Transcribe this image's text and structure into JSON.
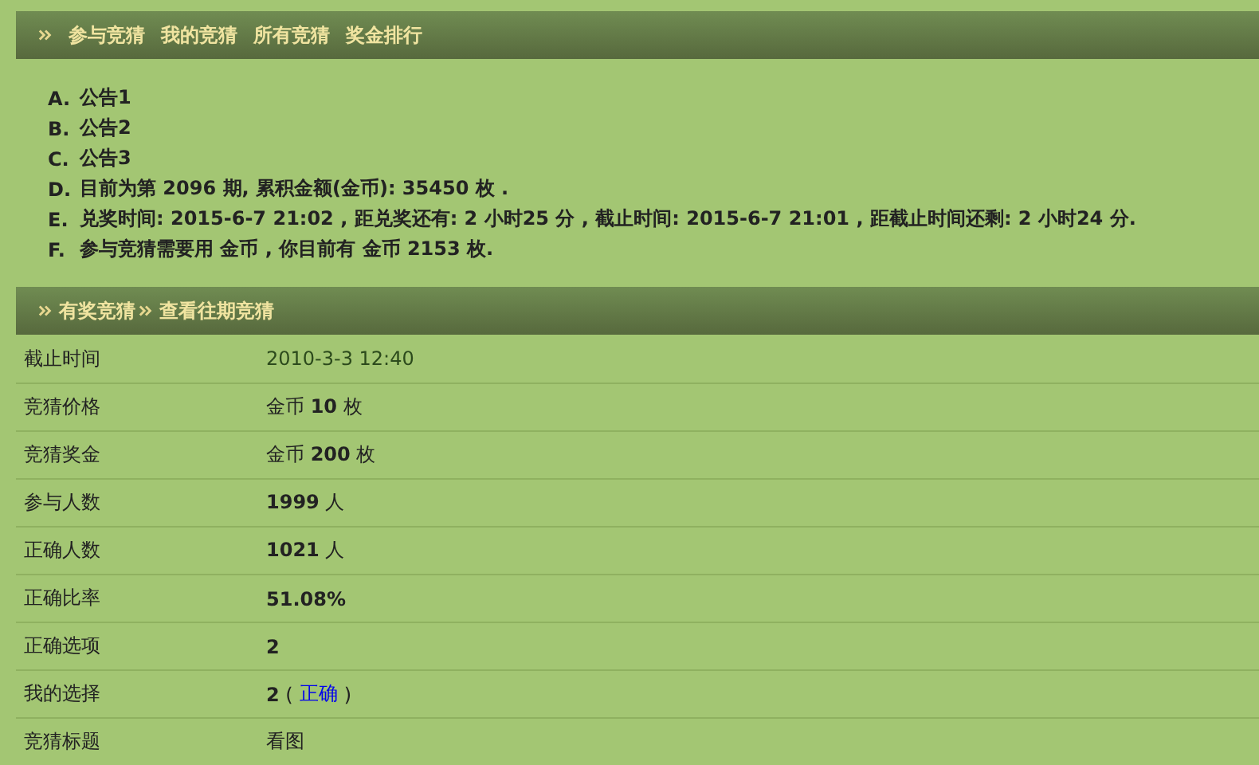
{
  "nav_bar": {
    "items": [
      "参与竞猜",
      "我的竞猜",
      "所有竞猜",
      "奖金排行"
    ]
  },
  "notices": [
    {
      "marker": "A.",
      "text": "公告1"
    },
    {
      "marker": "B.",
      "text": "公告2"
    },
    {
      "marker": "C.",
      "text": "公告3"
    },
    {
      "marker": "D.",
      "text": "目前为第 2096 期, 累积金额(金币): 35450 枚 ."
    },
    {
      "marker": "E.",
      "text": "兑奖时间: 2015-6-7 21:02 , 距兑奖还有: 2 小时25 分 , 截止时间: 2015-6-7 21:01 , 距截止时间还剩: 2 小时24 分."
    },
    {
      "marker": "F.",
      "text": "参与竞猜需要用 金币 , 你目前有 金币 2153 枚."
    }
  ],
  "section_header": {
    "crumbs": [
      "有奖竞猜",
      "查看往期竞猜"
    ]
  },
  "details": [
    {
      "label": "截止时间",
      "value": "2010-3-3 12:40",
      "kind": "date"
    },
    {
      "label": "竞猜价格",
      "value": "金币 **10** 枚",
      "kind": "plain"
    },
    {
      "label": "竞猜奖金",
      "value": "金币 **200** 枚",
      "kind": "plain"
    },
    {
      "label": "参与人数",
      "value": "**1999** 人",
      "kind": "plain"
    },
    {
      "label": "正确人数",
      "value": "**1021** 人",
      "kind": "plain"
    },
    {
      "label": "正确比率",
      "value": "**51.08%**",
      "kind": "plain"
    },
    {
      "label": "正确选项",
      "value": "**2**",
      "kind": "plain"
    },
    {
      "label": "我的选择",
      "value": "**2** (",
      "link": "正确",
      "suffix": ")",
      "kind": "link"
    },
    {
      "label": "竞猜标题",
      "value": "看图",
      "kind": "plain"
    }
  ]
}
